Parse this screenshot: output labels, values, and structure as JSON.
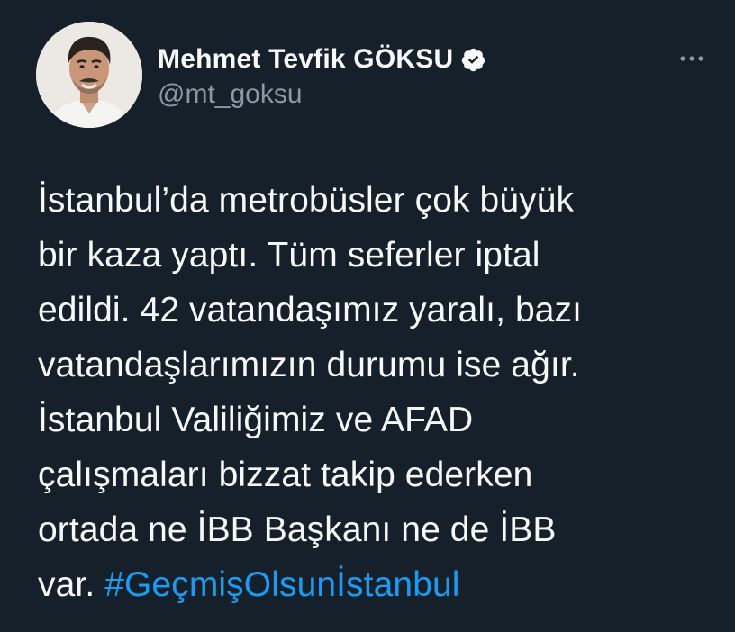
{
  "author": {
    "display_name": "Mehmet Tevfik GÖKSU",
    "handle": "@mt_goksu",
    "verified_icon": "verified-badge-icon",
    "avatar": "profile-photo"
  },
  "menu": {
    "more_icon": "more-horizontal-icon"
  },
  "tweet": {
    "body": "İstanbul’da metrobüsler çok büyük\nbir kaza yaptı. Tüm seferler iptal\nedildi. 42 vatandaşımız yaralı, bazı\nvatandaşlarımızın durumu ise ağır.\nİstanbul Valiliğimiz ve AFAD\nçalışmaları bizzat takip ederken\nortada ne İBB Başkanı ne de İBB\nvar. ",
    "hashtag": "#GeçmişOlsunİstanbul"
  },
  "colors": {
    "background": "#15202b",
    "text": "#f7f9f9",
    "secondary": "#8b98a5",
    "accent": "#1d9bf0"
  }
}
